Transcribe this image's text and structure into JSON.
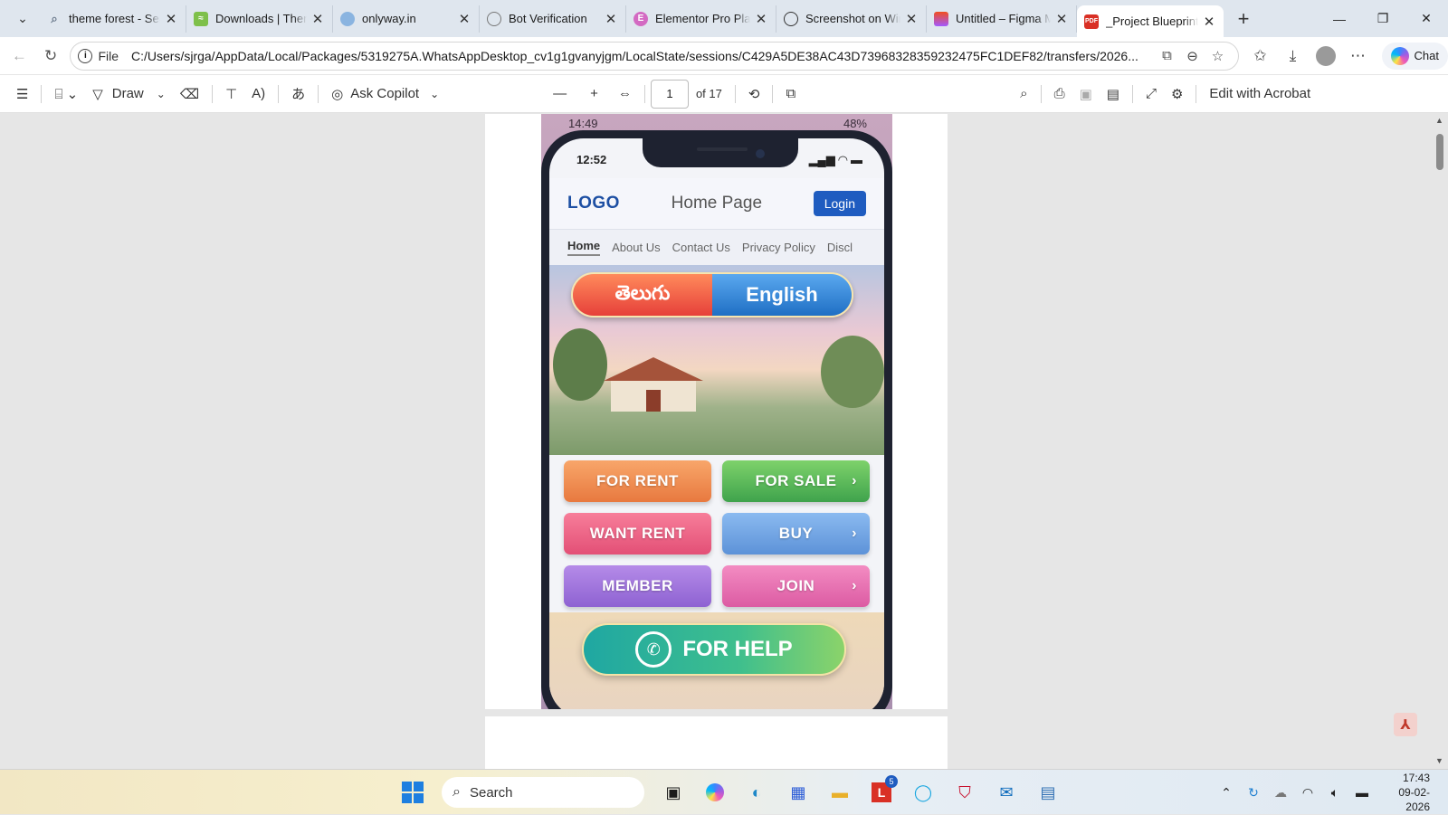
{
  "browser": {
    "tabs": [
      {
        "title": "theme forest - Sear",
        "favicon": "search-icon",
        "color": "#6b7a8c"
      },
      {
        "title": "Downloads | Theme",
        "favicon": "themeforest-icon",
        "color": "#7ec04a"
      },
      {
        "title": "onlyway.in",
        "favicon": "globe-icon",
        "color": "#8ab4e0"
      },
      {
        "title": "Bot Verification",
        "favicon": "globe-icon",
        "color": "#777777"
      },
      {
        "title": "Elementor Pro Plan",
        "favicon": "elementor-icon",
        "color": "#d36ac2"
      },
      {
        "title": "Screenshot on Win",
        "favicon": "chatgpt-icon",
        "color": "#333333"
      },
      {
        "title": "Untitled – Figma M",
        "favicon": "figma-icon",
        "color": "#f24e1e"
      },
      {
        "title": "_Project Blueprint_",
        "favicon": "pdf-icon",
        "color": "#d93025"
      }
    ],
    "new_tab_symbol": "+",
    "address": {
      "scheme": "File",
      "url": "C:/Users/sjrga/AppData/Local/Packages/5319275A.WhatsAppDesktop_cv1g1gvanyjgm/LocalState/sessions/C429A5DE38AC43D73968328359232475FC1DEF82/transfers/2026..."
    },
    "chat_label": "Chat"
  },
  "pdf_toolbar": {
    "draw_label": "Draw",
    "ask_copilot_label": "Ask Copilot",
    "page_number": "1",
    "page_total": "of 17",
    "edit_acrobat_label": "Edit with Acrobat"
  },
  "screenshot": {
    "outer_status": {
      "time": "14:49",
      "battery": "48%"
    },
    "phone_time": "12:52",
    "app": {
      "logo": "LOGO",
      "title": "Home Page",
      "login_label": "Login",
      "nav": [
        "Home",
        "About Us",
        "Contact Us",
        "Privacy Policy",
        "Discl"
      ],
      "lang_telugu": "తెలుగు",
      "lang_english": "English",
      "buttons": {
        "for_rent": "FOR RENT",
        "for_sale": "FOR SALE",
        "want_rent": "WANT RENT",
        "buy": "BUY",
        "member": "MEMBER",
        "join": "JOIN"
      },
      "help_label": "FOR HELP"
    }
  },
  "taskbar": {
    "search_label": "Search",
    "notification_count": "5",
    "time": "17:43",
    "date": "09-02-2026"
  }
}
